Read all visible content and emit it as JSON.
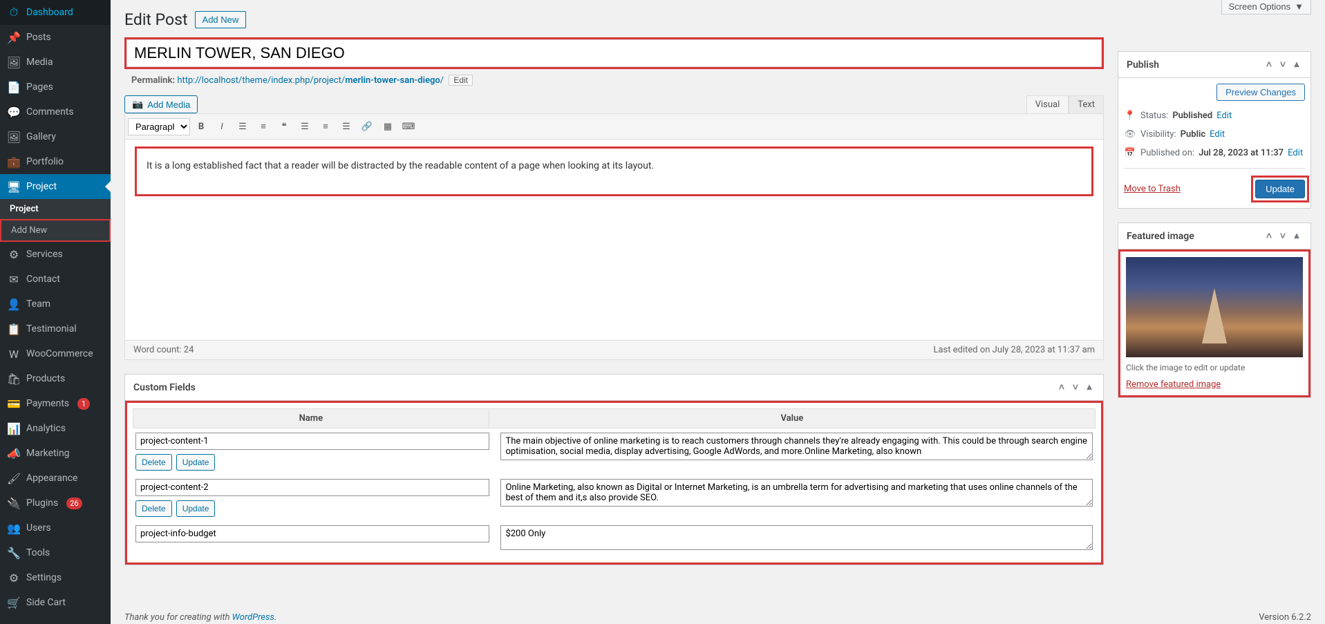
{
  "topbar": {
    "screen_options": "Screen Options"
  },
  "sidebar": {
    "items": [
      {
        "label": "Dashboard",
        "icon": "⏱"
      },
      {
        "label": "Posts",
        "icon": "📌"
      },
      {
        "label": "Media",
        "icon": "🖼"
      },
      {
        "label": "Pages",
        "icon": "📄"
      },
      {
        "label": "Comments",
        "icon": "💬"
      },
      {
        "label": "Gallery",
        "icon": "🖼"
      },
      {
        "label": "Portfolio",
        "icon": "💼"
      },
      {
        "label": "Project",
        "icon": "🖥"
      },
      {
        "label": "Services",
        "icon": "⚙"
      },
      {
        "label": "Contact",
        "icon": "✉"
      },
      {
        "label": "Team",
        "icon": "👤"
      },
      {
        "label": "Testimonial",
        "icon": "📋"
      },
      {
        "label": "WooCommerce",
        "icon": "W"
      },
      {
        "label": "Products",
        "icon": "🛍"
      },
      {
        "label": "Payments",
        "icon": "💳",
        "badge": "1"
      },
      {
        "label": "Analytics",
        "icon": "📊"
      },
      {
        "label": "Marketing",
        "icon": "📣"
      },
      {
        "label": "Appearance",
        "icon": "🖌"
      },
      {
        "label": "Plugins",
        "icon": "🔌",
        "badge": "26"
      },
      {
        "label": "Users",
        "icon": "👥"
      },
      {
        "label": "Tools",
        "icon": "🔧"
      },
      {
        "label": "Settings",
        "icon": "⚙"
      },
      {
        "label": "Side Cart",
        "icon": "🛒"
      }
    ],
    "submenu": {
      "parent_index": 7,
      "items": [
        "Project",
        "Add New"
      ],
      "current_index": 0,
      "highlight_index": 1
    }
  },
  "header": {
    "title": "Edit Post",
    "add_new": "Add New"
  },
  "post": {
    "title": "MERLIN TOWER, SAN DIEGO",
    "permalink_label": "Permalink:",
    "permalink_base": "http://localhost/theme/index.php/project/",
    "permalink_slug": "merlin-tower-san-diego",
    "permalink_trail": "/",
    "edit_label": "Edit"
  },
  "editor": {
    "add_media": "Add Media",
    "tab_visual": "Visual",
    "tab_text": "Text",
    "format_select": "Paragraph",
    "content": "It is a long established fact that a reader will be distracted by the readable content of a page when looking at its layout.",
    "word_count_label": "Word count: ",
    "word_count": "24",
    "last_edited": "Last edited on July 28, 2023 at 11:37 am"
  },
  "custom_fields": {
    "title": "Custom Fields",
    "col_name": "Name",
    "col_value": "Value",
    "delete_label": "Delete",
    "update_label": "Update",
    "rows": [
      {
        "name": "project-content-1",
        "value": "The main objective of online marketing is to reach customers through channels they're already engaging with. This could be through search engine optimisation, social media, display advertising, Google AdWords, and more.Online Marketing, also known"
      },
      {
        "name": "project-content-2",
        "value": "Online Marketing, also known as Digital or Internet Marketing, is an umbrella term for advertising and marketing that uses online channels of the best of them and it,s also provide SEO."
      },
      {
        "name": "project-info-budget",
        "value": "$200 Only"
      }
    ]
  },
  "publish": {
    "title": "Publish",
    "preview": "Preview Changes",
    "status_label": "Status:",
    "status_value": "Published",
    "visibility_label": "Visibility:",
    "visibility_value": "Public",
    "published_label": "Published on:",
    "published_value": "Jul 28, 2023 at 11:37",
    "edit": "Edit",
    "trash": "Move to Trash",
    "update": "Update"
  },
  "featured": {
    "title": "Featured image",
    "help": "Click the image to edit or update",
    "remove": "Remove featured image"
  },
  "footer": {
    "credit_prefix": "Thank you for creating with ",
    "credit_link": "WordPress",
    "credit_suffix": ".",
    "version": "Version 6.2.2"
  }
}
